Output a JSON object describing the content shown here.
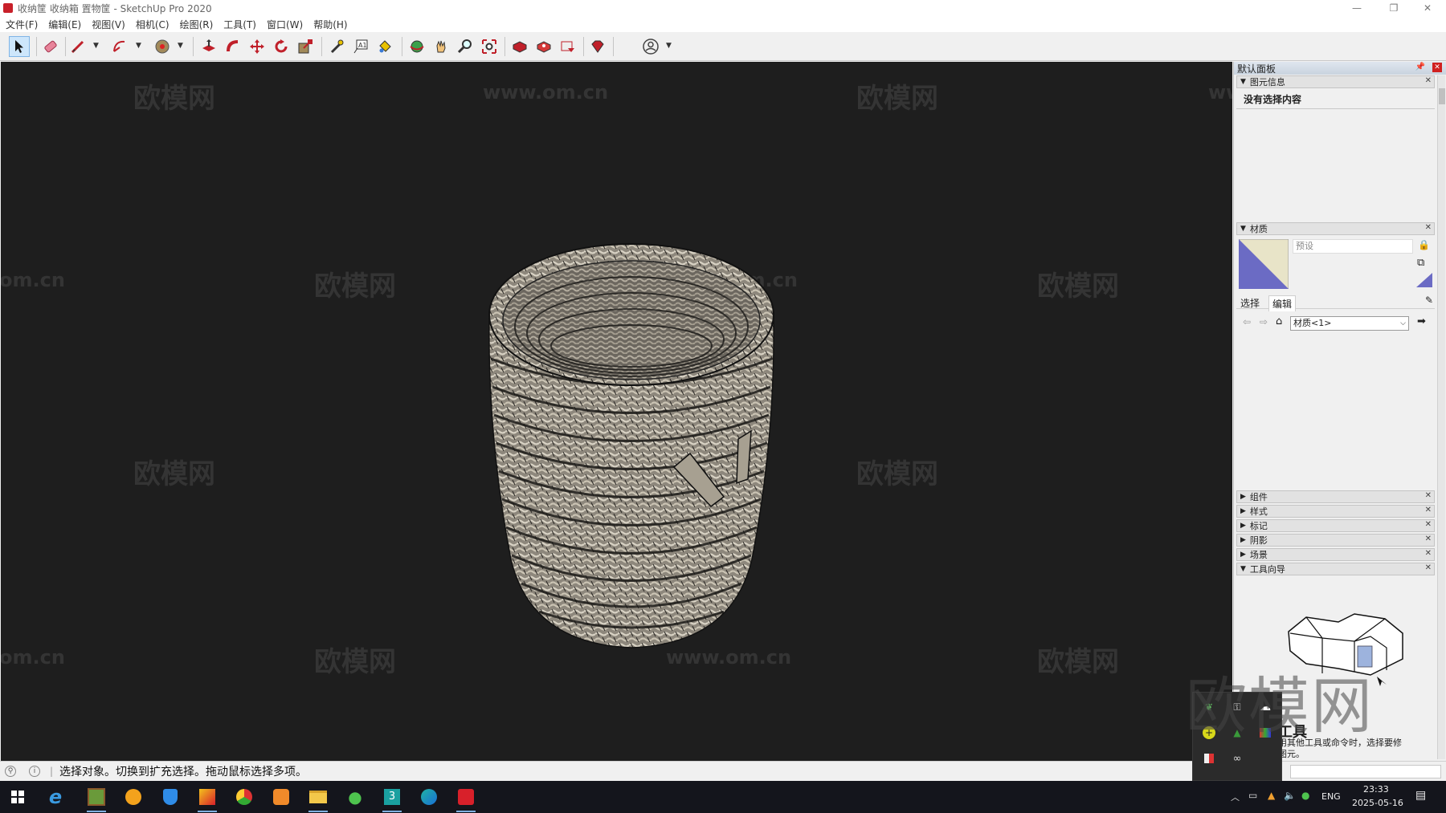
{
  "window": {
    "title": "收纳筐 收纳箱 置物筐 - SketchUp Pro 2020",
    "controls": {
      "minimize": "—",
      "restore": "❐",
      "close": "✕"
    }
  },
  "menu": [
    "文件(F)",
    "编辑(E)",
    "视图(V)",
    "相机(C)",
    "绘图(R)",
    "工具(T)",
    "窗口(W)",
    "帮助(H)"
  ],
  "toolbar_icons": [
    "select-icon",
    "eraser-icon",
    "line-icon",
    "arc-icon",
    "shape-icon",
    "push-pull-icon",
    "follow-me-icon",
    "move-icon",
    "rotate-icon",
    "scale-icon",
    "tape-measure-icon",
    "text-icon",
    "paint-bucket-icon",
    "orbit-icon",
    "pan-icon",
    "zoom-icon",
    "zoom-extents-icon",
    "3d-warehouse-icon",
    "extension-warehouse-icon",
    "layout-icon",
    "extension-manager-icon",
    "account-icon"
  ],
  "watermarks": {
    "brand": "欧模网",
    "url": "www.om.cn",
    "partial": "om.cn"
  },
  "panel": {
    "title": "默认面板",
    "entity_info": {
      "title": "图元信息",
      "body": "没有选择内容"
    },
    "materials": {
      "title": "材质",
      "name_field": "预设",
      "tabs": [
        "选择",
        "编辑"
      ],
      "collection": "材质<1>"
    },
    "collapsed_sections": [
      "组件",
      "样式",
      "标记",
      "阴影",
      "场景"
    ],
    "instructor": {
      "title": "工具向导",
      "heading": "工具",
      "text1": "用其他工具或命令时，选择要修",
      "text2": "图元。"
    }
  },
  "status": {
    "message": "选择对象。切换到扩充选择。拖动鼠标选择多项。"
  },
  "taskbar": {
    "lang": "ENG",
    "time": "23:33",
    "date": "2025-05-16"
  },
  "colors": {
    "viewport_bg": "#1e1e1e",
    "taskbar_bg": "#14151c",
    "material_swatch": "#6b6bc4",
    "accent_red": "#c8202a"
  }
}
